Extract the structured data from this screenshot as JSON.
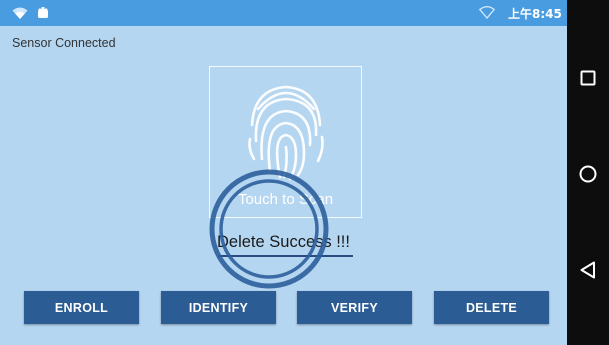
{
  "status_bar": {
    "time": "上午8:45",
    "icons": [
      "wifi-icon",
      "android-icon",
      "signal-icon"
    ]
  },
  "sensor_status": "Sensor Connected",
  "scan_area": {
    "label": "Touch to Scan",
    "icon": "fingerprint-icon"
  },
  "result_message": "Delete Success !!!",
  "buttons": {
    "enroll": "ENROLL",
    "identify": "IDENTIFY",
    "verify": "VERIFY",
    "delete": "DELETE"
  },
  "nav_bar": {
    "icons": [
      "recents-icon",
      "home-icon",
      "back-icon"
    ]
  },
  "colors": {
    "status_bar": "#4a9ce0",
    "background": "#b5d6f0",
    "button": "#2b5d94",
    "touch_ring": "#2e5f9c"
  }
}
